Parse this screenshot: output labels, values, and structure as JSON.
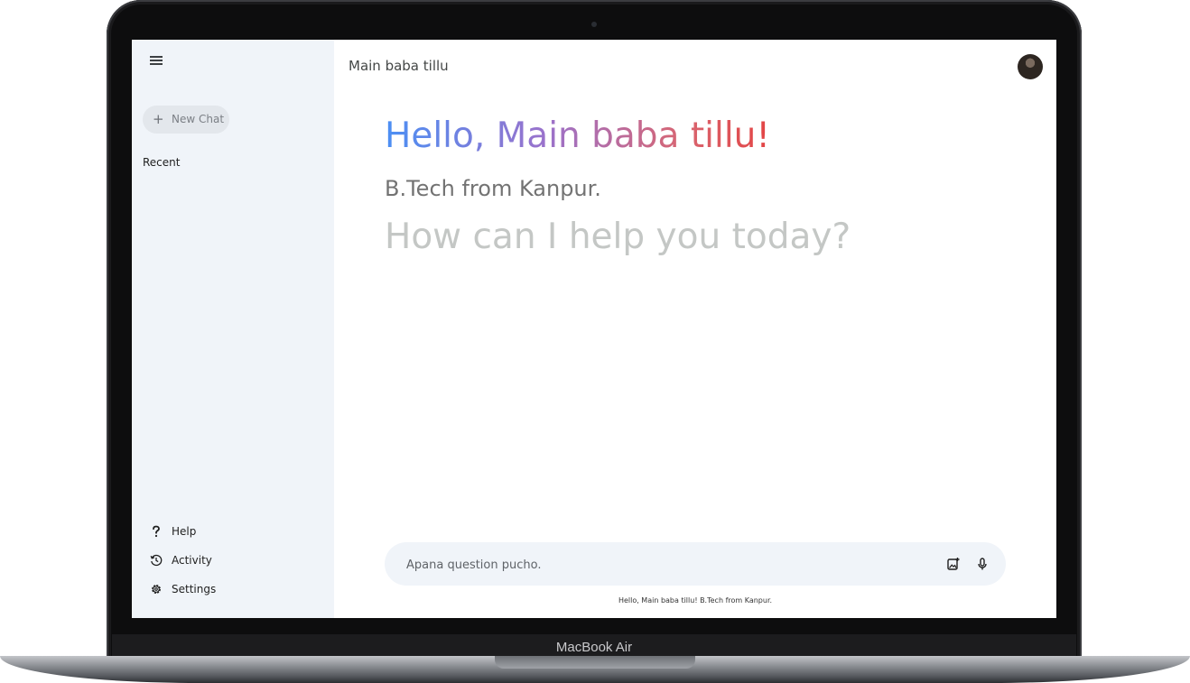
{
  "device": {
    "label": "MacBook Air"
  },
  "sidebar": {
    "new_chat_label": "New Chat",
    "recent_label": "Recent",
    "bottom_items": [
      {
        "label": "Help",
        "icon": "help-icon"
      },
      {
        "label": "Activity",
        "icon": "history-icon"
      },
      {
        "label": "Settings",
        "icon": "gear-icon"
      }
    ]
  },
  "header": {
    "title": "Main baba tillu"
  },
  "greeting": {
    "hello": "Hello, Main baba tillu!",
    "subtitle": "B.Tech from Kanpur.",
    "prompt": "How can I help you today?"
  },
  "input": {
    "placeholder": "Apana question pucho.",
    "value": ""
  },
  "footer": {
    "note": "Hello, Main baba tillu! B.Tech from Kanpur."
  },
  "colors": {
    "sidebar_bg": "#f0f4f9",
    "gradient": [
      "#4b8ff4",
      "#9b72cb",
      "#d96570",
      "#e34444"
    ],
    "prompt_text": "#c4c7c5"
  }
}
